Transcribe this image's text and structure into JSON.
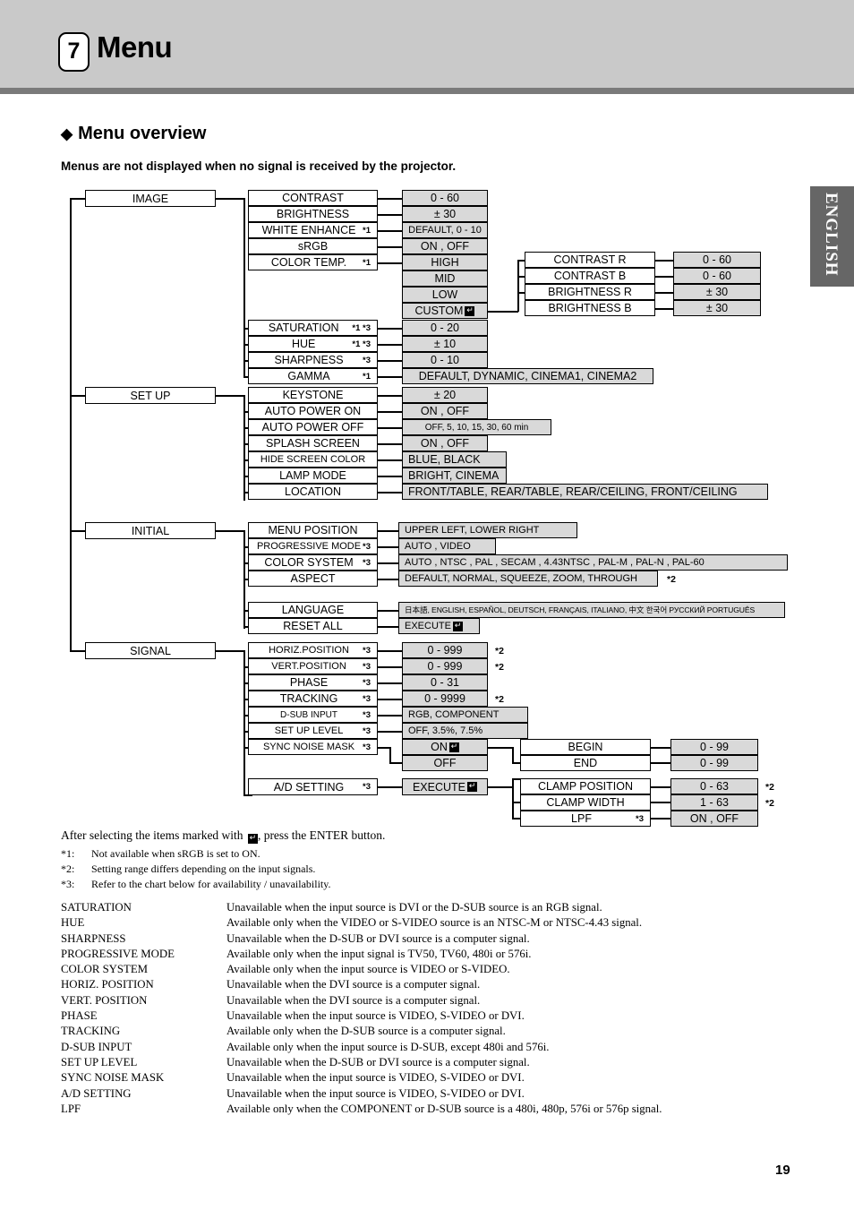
{
  "header": {
    "chapter_number": "7",
    "chapter_title": "Menu",
    "side_tab": "ENGLISH"
  },
  "overview": {
    "heading": "Menu overview",
    "heading_bullet": "◆",
    "subtitle": "Menus are not displayed when no signal is received by the projector."
  },
  "diagram": {
    "roots": {
      "image": "IMAGE",
      "setup": "SET UP",
      "initial": "INITIAL",
      "signal": "SIGNAL"
    },
    "image_items": [
      {
        "label": "CONTRAST",
        "sup": "",
        "value": "0 - 60"
      },
      {
        "label": "BRIGHTNESS",
        "sup": "",
        "value": "± 30"
      },
      {
        "label": "WHITE ENHANCE",
        "sup": "*1",
        "value": "DEFAULT, 0 - 10"
      },
      {
        "label": "sRGB",
        "sup": "",
        "value": "ON , OFF"
      },
      {
        "label": "COLOR TEMP.",
        "sup": "*1",
        "value": "HIGH"
      }
    ],
    "color_temp_values": [
      "HIGH",
      "MID",
      "LOW",
      "CUSTOM"
    ],
    "color_temp_custom_label": "CUSTOM",
    "image_items2": [
      {
        "label": "SATURATION",
        "sup": "*1 *3",
        "value": "0 - 20"
      },
      {
        "label": "HUE",
        "sup": "*1 *3",
        "value": "± 10"
      },
      {
        "label": "SHARPNESS",
        "sup": "*3",
        "value": "0 - 10"
      },
      {
        "label": "GAMMA",
        "sup": "*1",
        "value": "DEFAULT, DYNAMIC, CINEMA1, CINEMA2"
      }
    ],
    "custom_sub": [
      {
        "label": "CONTRAST R",
        "value": "0 - 60"
      },
      {
        "label": "CONTRAST B",
        "value": "0 - 60"
      },
      {
        "label": "BRIGHTNESS R",
        "value": "± 30"
      },
      {
        "label": "BRIGHTNESS B",
        "value": "± 30"
      }
    ],
    "setup_items": [
      {
        "label": "KEYSTONE",
        "sup": "",
        "value": "± 20"
      },
      {
        "label": "AUTO POWER ON",
        "sup": "",
        "value": "ON , OFF"
      },
      {
        "label": "AUTO POWER OFF",
        "sup": "",
        "value": "OFF,  5,  10,  15,  30,  60 min"
      },
      {
        "label": "SPLASH SCREEN",
        "sup": "",
        "value": "ON , OFF"
      },
      {
        "label": "HIDE SCREEN COLOR",
        "sup": "",
        "value": "BLUE, BLACK"
      },
      {
        "label": "LAMP MODE",
        "sup": "",
        "value": "BRIGHT, CINEMA"
      },
      {
        "label": "LOCATION",
        "sup": "",
        "value": "FRONT/TABLE, REAR/TABLE, REAR/CEILING, FRONT/CEILING"
      }
    ],
    "initial_items": [
      {
        "label": "MENU POSITION",
        "sup": "",
        "value": "UPPER LEFT, LOWER RIGHT",
        "note": ""
      },
      {
        "label": "PROGRESSIVE MODE",
        "sup": "*3",
        "value": "AUTO , VIDEO",
        "note": ""
      },
      {
        "label": "COLOR SYSTEM",
        "sup": "*3",
        "value": "AUTO , NTSC , PAL , SECAM , 4.43NTSC , PAL-M , PAL-N , PAL-60",
        "note": ""
      },
      {
        "label": "ASPECT",
        "sup": "",
        "value": "DEFAULT, NORMAL, SQUEEZE, ZOOM, THROUGH",
        "note": "*2"
      }
    ],
    "initial_items2": [
      {
        "label": "LANGUAGE",
        "sup": "",
        "value": "日本語, ENGLISH, ESPAÑOL, DEUTSCH, FRANÇAIS, ITALIANO, 中文 한국어 РУССКИЙ PORTUGUÊS"
      },
      {
        "label": "RESET ALL",
        "sup": "",
        "value": "EXECUTE"
      }
    ],
    "signal_items": [
      {
        "label": "HORIZ.POSITION",
        "sup": "*3",
        "value": "0 - 999",
        "note": "*2"
      },
      {
        "label": "VERT.POSITION",
        "sup": "*3",
        "value": "0 - 999",
        "note": "*2"
      },
      {
        "label": "PHASE",
        "sup": "*3",
        "value": "0 - 31",
        "note": ""
      },
      {
        "label": "TRACKING",
        "sup": "*3",
        "value": "0 - 9999",
        "note": "*2"
      },
      {
        "label": "D-SUB INPUT",
        "sup": "*3",
        "value": "RGB, COMPONENT",
        "note": ""
      },
      {
        "label": "SET UP LEVEL",
        "sup": "*3",
        "value": "OFF, 3.5%, 7.5%",
        "note": ""
      },
      {
        "label": "SYNC NOISE MASK",
        "sup": "*3",
        "value": "ON",
        "note": ""
      }
    ],
    "sync_off_value": "OFF",
    "sync_sub": [
      {
        "label": "BEGIN",
        "value": "0 - 99"
      },
      {
        "label": "END",
        "value": "0 - 99"
      }
    ],
    "ad_setting": {
      "label": "A/D SETTING",
      "sup": "*3",
      "value": "EXECUTE"
    },
    "ad_sub": [
      {
        "label": "CLAMP POSITION",
        "sup": "",
        "value": "0 - 63",
        "note": "*2"
      },
      {
        "label": "CLAMP WIDTH",
        "sup": "",
        "value": "1 - 63",
        "note": "*2"
      },
      {
        "label": "LPF",
        "sup": "*3",
        "value": "ON , OFF",
        "note": ""
      }
    ]
  },
  "footnotes": {
    "lead_before": "After selecting the items marked with",
    "lead_after": ", press the ENTER button.",
    "items": [
      {
        "key": "*1:",
        "text": "Not available when sRGB is set to ON."
      },
      {
        "key": "*2:",
        "text": "Setting range differs depending on the input signals."
      },
      {
        "key": "*3:",
        "text": "Refer to the chart below for availability / unavailability."
      }
    ]
  },
  "availability": [
    {
      "name": "SATURATION",
      "text": "Unavailable when the input source is DVI or the D-SUB source is an RGB signal."
    },
    {
      "name": "HUE",
      "text": "Available only when the VIDEO or S-VIDEO source is an NTSC-M or NTSC-4.43 signal."
    },
    {
      "name": "SHARPNESS",
      "text": "Unavailable when the D-SUB or DVI source is a computer signal."
    },
    {
      "name": "PROGRESSIVE MODE",
      "text": "Available only when the input signal is TV50, TV60, 480i or 576i."
    },
    {
      "name": "COLOR SYSTEM",
      "text": "Available only when the input source is VIDEO or S-VIDEO."
    },
    {
      "name": "HORIZ. POSITION",
      "text": "Unavailable when the DVI source is a computer signal."
    },
    {
      "name": "VERT. POSITION",
      "text": "Unavailable when the DVI source is a computer signal."
    },
    {
      "name": "PHASE",
      "text": "Unavailable when the input source is VIDEO, S-VIDEO or DVI."
    },
    {
      "name": "TRACKING",
      "text": "Available only when the D-SUB source is a computer signal."
    },
    {
      "name": "D-SUB INPUT",
      "text": "Available only when the input source is D-SUB, except 480i and 576i."
    },
    {
      "name": "SET UP LEVEL",
      "text": "Unavailable when the D-SUB or DVI source is a computer signal."
    },
    {
      "name": "SYNC NOISE MASK",
      "text": "Unavailable when the input source is VIDEO, S-VIDEO or DVI."
    },
    {
      "name": "A/D SETTING",
      "text": "Unavailable when the input source is VIDEO, S-VIDEO or DVI."
    },
    {
      "name": "LPF",
      "text": "Available only when the COMPONENT or D-SUB source is a 480i, 480p, 576i or 576p signal."
    }
  ],
  "page_number": "19"
}
